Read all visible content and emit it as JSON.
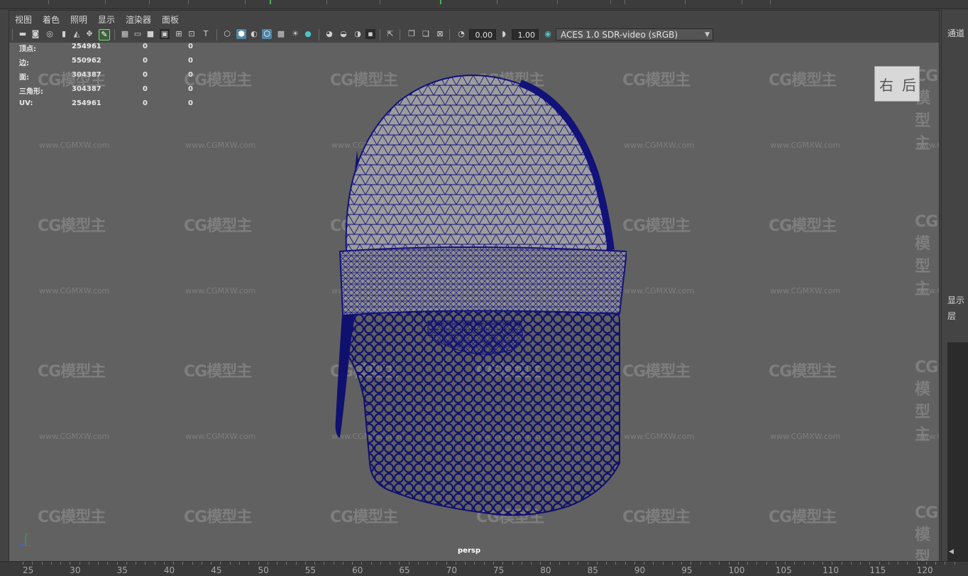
{
  "menu": {
    "items": [
      "视图",
      "着色",
      "照明",
      "显示",
      "渲染器",
      "面板"
    ]
  },
  "toolbar": {
    "field_exposure": "0.00",
    "field_gamma": "1.00",
    "color_space": "ACES 1.0 SDR-video (sRGB)",
    "icons": [
      "select-camera-icon",
      "camera-attributes-icon",
      "bookmark-icon",
      "image-plane-icon",
      "2d-pan-zoom-icon",
      "grease-pencil-icon",
      "grid-icon",
      "film-gate-icon",
      "resolution-gate-icon",
      "gate-mask-icon",
      "field-chart-icon",
      "safe-action-icon",
      "safe-title-icon",
      "wireframe-icon",
      "smooth-shade-icon",
      "use-default-material-icon",
      "wireframe-on-shaded-icon",
      "xray-icon",
      "textured-icon",
      "use-all-lights-icon",
      "shadows-icon",
      "screen-space-ao-icon",
      "motion-blur-icon",
      "multisample-aa-icon",
      "depth-of-field-icon",
      "isolate-select-icon",
      "xray-joints-icon",
      "xray-active-icon",
      "backface-culling-icon",
      "exposure-icon",
      "gamma-icon",
      "view-transform-icon"
    ]
  },
  "hud": {
    "rows": [
      {
        "label": "顶点:",
        "value": "254961",
        "sel": "0",
        "comp": "0"
      },
      {
        "label": "边:",
        "value": "550962",
        "sel": "0",
        "comp": "0"
      },
      {
        "label": "面:",
        "value": "304387",
        "sel": "0",
        "comp": "0"
      },
      {
        "label": "三角形:",
        "value": "304387",
        "sel": "0",
        "comp": "0"
      },
      {
        "label": "UV:",
        "value": "254961",
        "sel": "0",
        "comp": "0"
      }
    ]
  },
  "viewport": {
    "camera": "persp",
    "viewcube_faces": [
      "右",
      "后"
    ],
    "axis_labels": {
      "y": "y",
      "z": "z",
      "x": "x"
    },
    "watermark_logo": "CG模型主",
    "watermark_url": "www.CGMXW.com",
    "wire_color": "#12127a"
  },
  "right_panel": {
    "channel_box_label": "通道",
    "display_label": "显示",
    "layer_label": "层"
  },
  "timeline": {
    "ticks": [
      "25",
      "30",
      "35",
      "40",
      "45",
      "50",
      "55",
      "60",
      "65",
      "70",
      "75",
      "80",
      "85",
      "90",
      "95",
      "100",
      "105",
      "110",
      "115",
      "120"
    ]
  }
}
